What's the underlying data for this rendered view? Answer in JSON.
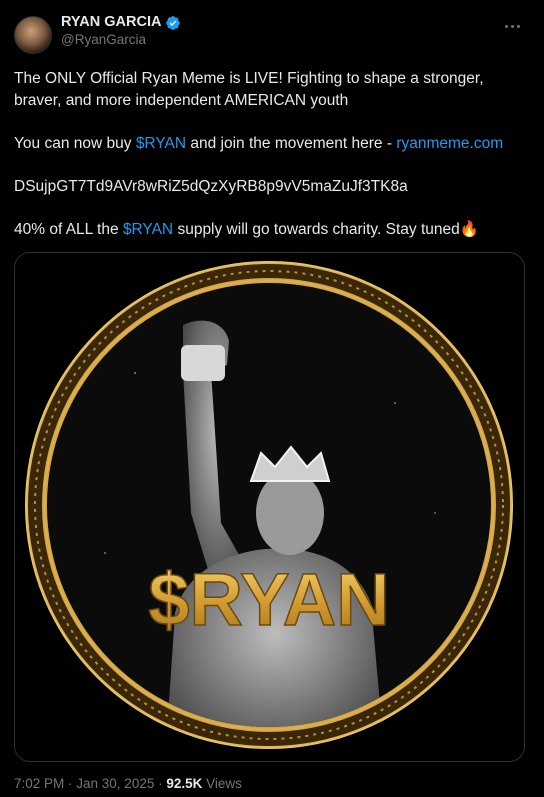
{
  "author": {
    "display_name": "RYAN GARCIA",
    "handle": "@RyanGarcia",
    "verified": true
  },
  "post": {
    "line1": "The ONLY Official Ryan Meme is LIVE! Fighting to shape a stronger, braver, and more independent AMERICAN youth",
    "line2_prefix": "You can now buy ",
    "line2_ticker": "$RYAN",
    "line2_middle": " and join the movement here - ",
    "line2_link": "ryanmeme.com",
    "contract_address": "DSujpGT7Td9AVr8wRiZ5dQzXyRB8p9vV5maZuJf3TK8a",
    "line4_prefix": "40% of ALL the ",
    "line4_ticker": "$RYAN",
    "line4_suffix": " supply will go towards charity. Stay tuned",
    "line4_emoji": "🔥"
  },
  "image": {
    "coin_text": "$RYAN"
  },
  "meta": {
    "timestamp": "7:02 PM · Jan 30, 2025 · ",
    "views_count": "92.5K",
    "views_label": " Views"
  },
  "colors": {
    "link": "#1d9bf0",
    "gold": "#d4a640",
    "background": "#000000"
  },
  "icons": [
    "verified-badge-icon",
    "more-options-icon"
  ]
}
